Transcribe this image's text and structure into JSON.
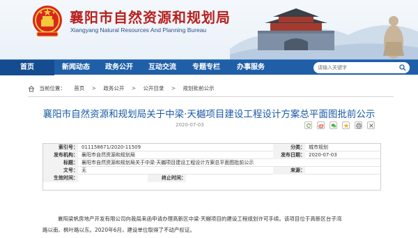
{
  "header": {
    "title_cn": "襄阳市自然资源和规划局",
    "title_en": "Xiangyang Natural Resources And Planning Bureau"
  },
  "nav": {
    "items": [
      "首页",
      "新闻动态",
      "政务公开",
      "互动交流",
      "专题专栏",
      "办事服务"
    ],
    "search_placeholder": "请输入关键字"
  },
  "breadcrumb": {
    "prefix": "当前位置：",
    "items": [
      "首页",
      "政务公开",
      "公开目录",
      "规划批前公示"
    ],
    "separator": ">"
  },
  "article": {
    "title": "襄阳市自然资源和规划局关于中梁·天樾项目建设工程设计方案总平面图批前公示",
    "date": "2020-07-03"
  },
  "meta": {
    "index_label": "索引号：",
    "index_value": "011158671/2020-11509",
    "category_label": "分类：",
    "category_value": "城市规划",
    "publisher_label": "发布机构：",
    "publisher_value": "襄阳市自然资源和规划局",
    "pubdate_label": "发布日期：",
    "pubdate_value": "2020-07-03",
    "subject_label": "标题：",
    "subject_value": "襄阳市自然资源和规划局关于中梁·天樾项目建设工程设计方案总平面图批前公示",
    "docno_label": "文号：",
    "docno_value": "无",
    "source_label": "来源：",
    "source_value": "",
    "effective_label": "生效时间：",
    "effective_value": "",
    "expire_label": "终止时间：",
    "expire_value": ""
  },
  "body": {
    "line1": "襄阳梁帆房地产开发有限公司向我局来函申请办理高新区中梁·天樾项目的建设工程规划许可手续。该项目位于高新区台子湾",
    "line2": "路以南、枫叶路以东。2020年6月，建设单位取得了不动产权证。"
  },
  "colors": {
    "nav_bg": "#1f5fa8",
    "title_red": "#b8201e",
    "article_title_blue": "#1a5aa8"
  },
  "icons": [
    "national-emblem-icon",
    "search-icon",
    "home-icon",
    "refresh-icon",
    "weibo-icon",
    "wechat-icon",
    "qzone-icon",
    "print-icon",
    "close-icon"
  ]
}
